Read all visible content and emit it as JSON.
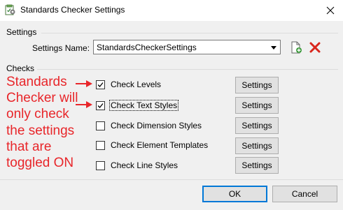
{
  "window": {
    "title": "Standards Checker Settings",
    "close_label": "×"
  },
  "settings_group": {
    "label": "Settings",
    "name_label": "Settings Name:",
    "name_value": "StandardsCheckerSettings",
    "new_icon": "new-document-icon",
    "delete_icon": "delete-x-icon"
  },
  "checks_group": {
    "label": "Checks",
    "items": [
      {
        "label": "Check Levels",
        "checked": true,
        "button": "Settings"
      },
      {
        "label": "Check Text Styles",
        "checked": true,
        "button": "Settings"
      },
      {
        "label": "Check Dimension Styles",
        "checked": false,
        "button": "Settings"
      },
      {
        "label": "Check Element Templates",
        "checked": false,
        "button": "Settings"
      },
      {
        "label": "Check Line Styles",
        "checked": false,
        "button": "Settings"
      }
    ]
  },
  "annotation": {
    "lines": [
      "Standards",
      "Checker will",
      "only check",
      "the settings",
      "that are",
      "toggled ON"
    ],
    "color": "#e8262a"
  },
  "footer": {
    "ok_label": "OK",
    "cancel_label": "Cancel"
  },
  "colors": {
    "accent": "#0078d7",
    "delete_red": "#d9261c"
  }
}
